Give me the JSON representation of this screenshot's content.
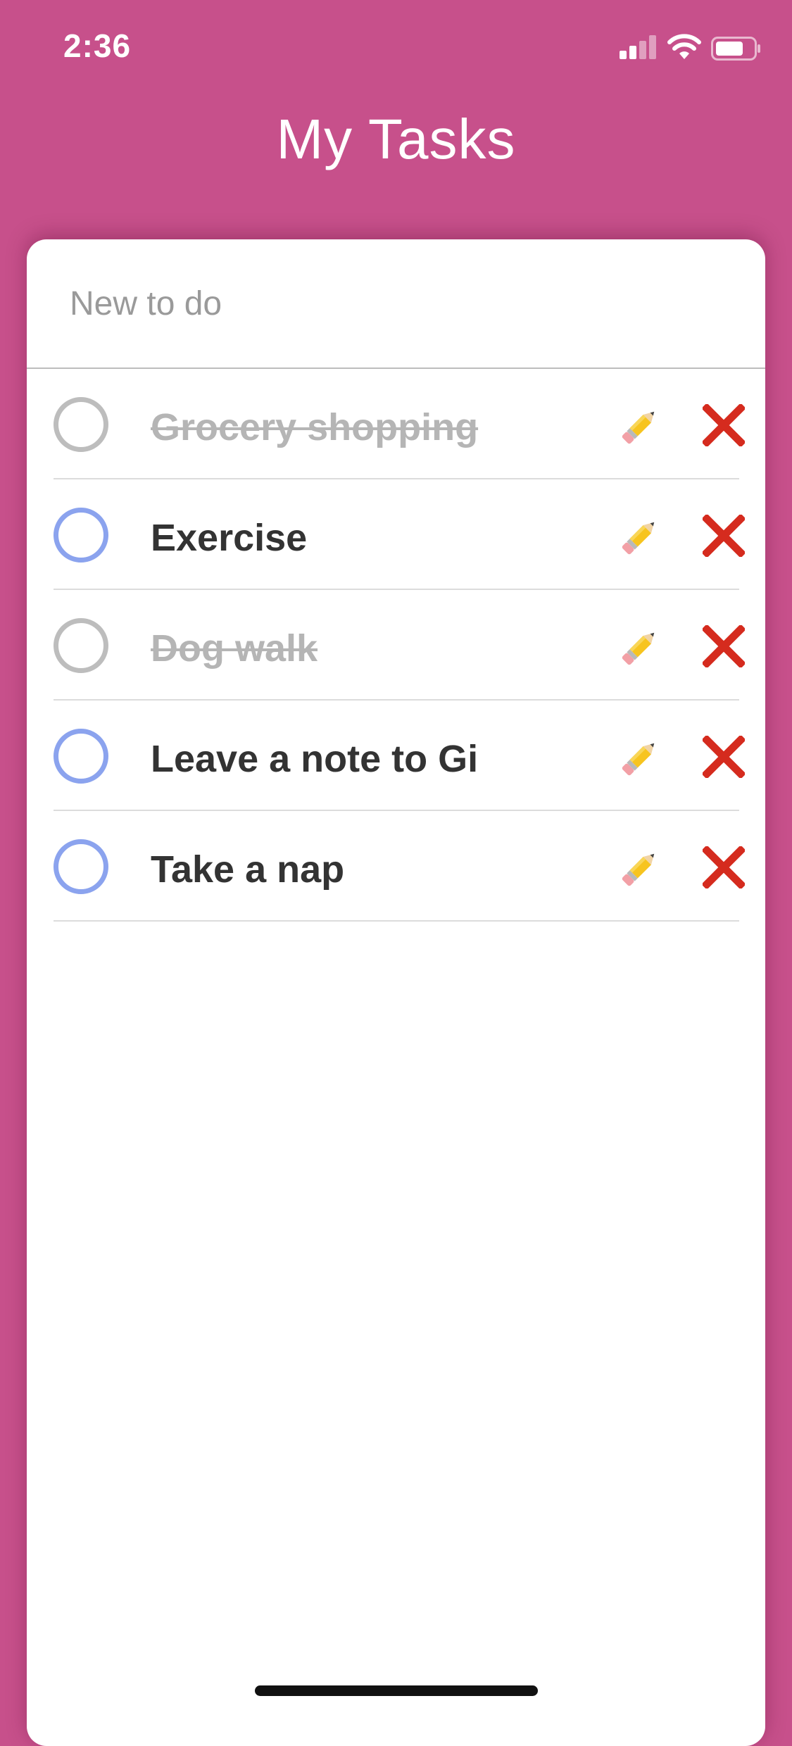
{
  "status_bar": {
    "time": "2:36",
    "signal_icon": "cellular-signal-icon",
    "wifi_icon": "wifi-icon",
    "battery_icon": "battery-icon"
  },
  "header": {
    "title": "My Tasks"
  },
  "new_todo": {
    "placeholder": "New to do",
    "value": ""
  },
  "tasks": [
    {
      "label": "Grocery shopping",
      "done": true
    },
    {
      "label": "Exercise",
      "done": false
    },
    {
      "label": "Dog walk",
      "done": true
    },
    {
      "label": "Leave a note to Gi",
      "done": false
    },
    {
      "label": "Take a nap",
      "done": false
    }
  ],
  "icons": {
    "edit": "pencil-icon",
    "delete": "close-icon"
  },
  "colors": {
    "background": "#c7508b",
    "card": "#ffffff",
    "checkbox_active": "#8ba3ee",
    "checkbox_done": "#bdbdbd",
    "delete": "#d52b1e",
    "text": "#333333",
    "text_done": "#b5b5b5"
  }
}
